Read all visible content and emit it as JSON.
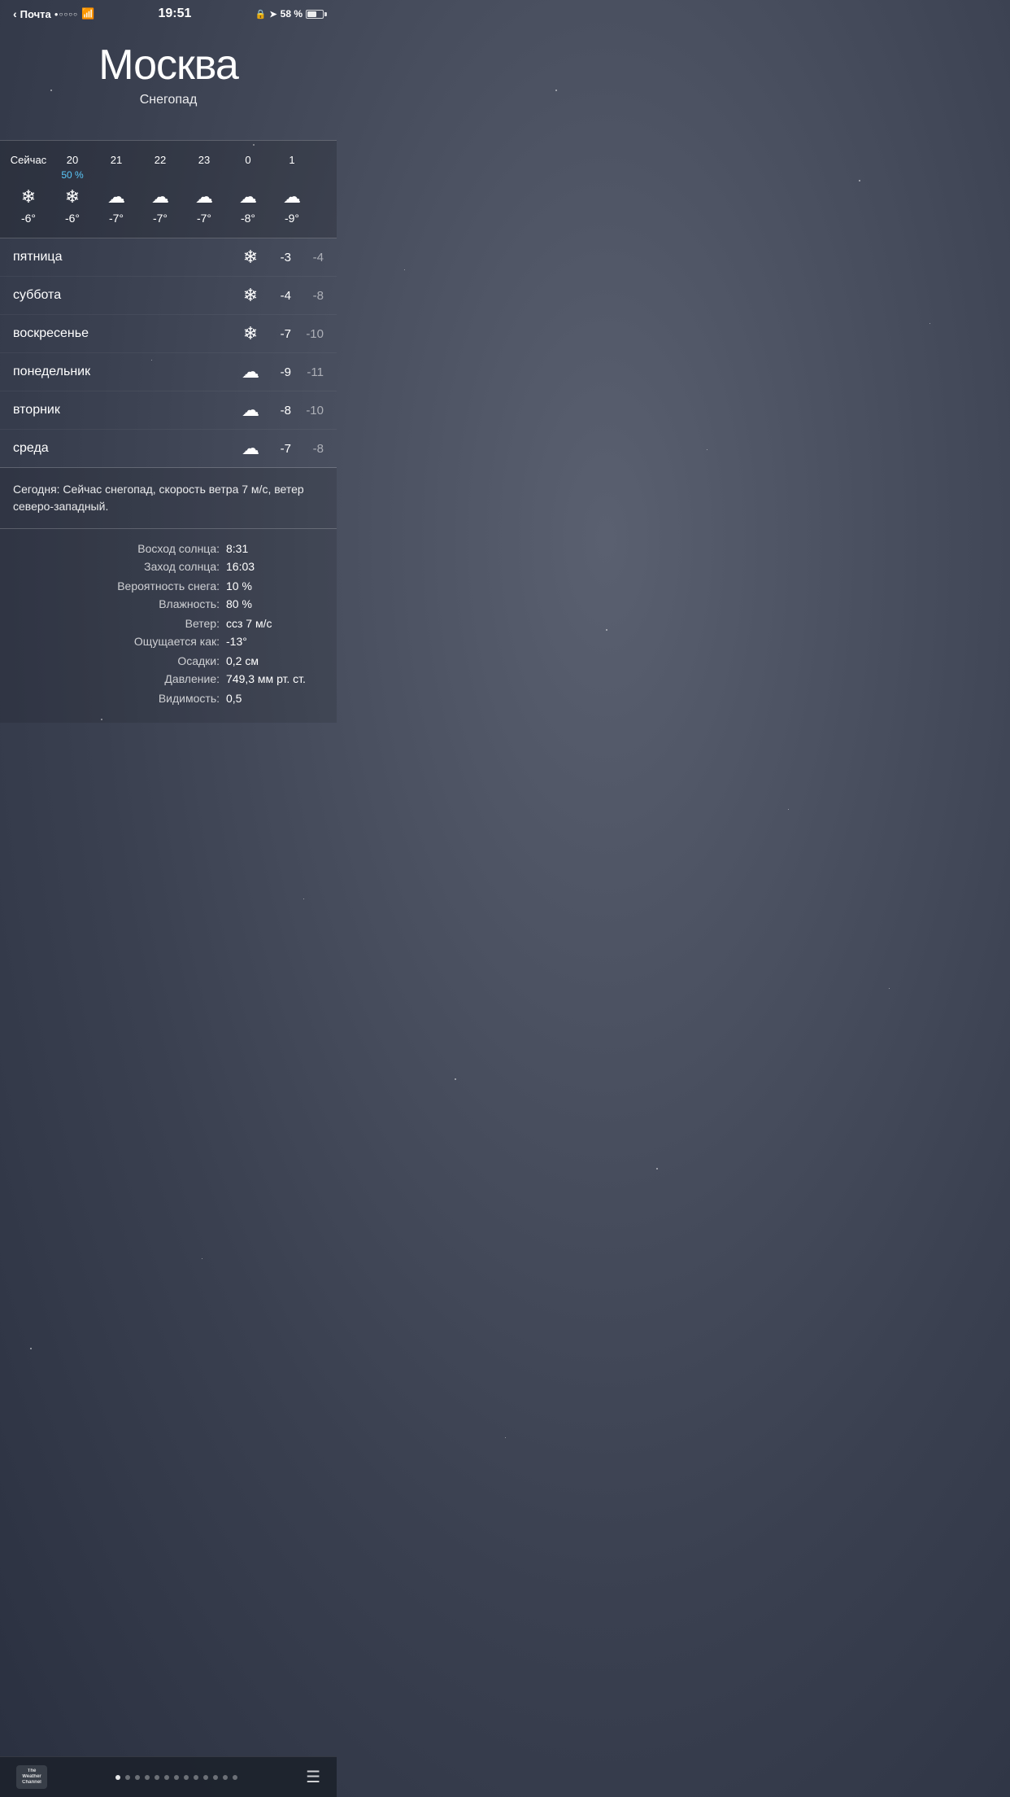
{
  "status_bar": {
    "back_label": "Почта",
    "signal_dots": "●○○○○",
    "wifi_label": "wifi",
    "time": "19:51",
    "lock_icon": "🔒",
    "location_icon": "➤",
    "battery_percent": "58 %"
  },
  "header": {
    "city": "Москва",
    "condition": "Снегопад"
  },
  "hourly": [
    {
      "hour": "Сейчас",
      "precip": "",
      "icon": "❄",
      "temp": "-6°"
    },
    {
      "hour": "20",
      "precip": "50 %",
      "icon": "❄",
      "temp": "-6°"
    },
    {
      "hour": "21",
      "precip": "",
      "icon": "☁",
      "temp": "-7°"
    },
    {
      "hour": "22",
      "precip": "",
      "icon": "☁",
      "temp": "-7°"
    },
    {
      "hour": "23",
      "precip": "",
      "icon": "☁",
      "temp": "-7°"
    },
    {
      "hour": "0",
      "precip": "",
      "icon": "☁",
      "temp": "-8°"
    },
    {
      "hour": "1",
      "precip": "",
      "icon": "☁",
      "temp": "-9°"
    }
  ],
  "daily": [
    {
      "day": "пятница",
      "icon": "❄",
      "high": "-3",
      "low": "-4"
    },
    {
      "day": "суббота",
      "icon": "❄",
      "high": "-4",
      "low": "-8"
    },
    {
      "day": "воскресенье",
      "icon": "❄",
      "high": "-7",
      "low": "-10"
    },
    {
      "day": "понедельник",
      "icon": "☁",
      "high": "-9",
      "low": "-11"
    },
    {
      "day": "вторник",
      "icon": "☁",
      "high": "-8",
      "low": "-10"
    },
    {
      "day": "среда",
      "icon": "☁",
      "high": "-7",
      "low": "-8"
    }
  ],
  "description": "Сегодня: Сейчас снегопад, скорость ветра 7 м/с, ветер северо-западный.",
  "details": [
    {
      "label": "Восход солнца:",
      "value": "8:31"
    },
    {
      "label": "Заход солнца:",
      "value": "16:03"
    },
    {
      "label": "Вероятность снега:",
      "value": "10 %"
    },
    {
      "label": "Влажность:",
      "value": "80 %"
    },
    {
      "label": "Ветер:",
      "value": "ссз 7 м/с"
    },
    {
      "label": "Ощущается как:",
      "value": "-13°"
    },
    {
      "label": "Осадки:",
      "value": "0,2 см"
    },
    {
      "label": "Давление:",
      "value": "749,3 мм рт. ст."
    },
    {
      "label": "Видимость:",
      "value": "0,5"
    }
  ],
  "bottom_bar": {
    "brand_line1": "The",
    "brand_line2": "Weather",
    "brand_line3": "Channel",
    "pages_count": 13,
    "active_page": 0
  }
}
